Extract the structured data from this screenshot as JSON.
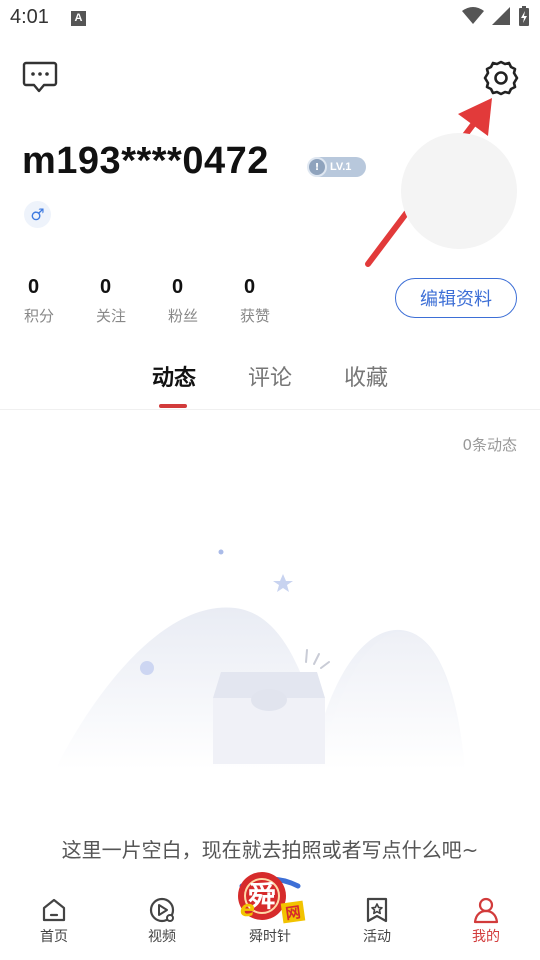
{
  "status_bar": {
    "time": "4:01",
    "notification_icon": "A"
  },
  "header": {
    "messages_icon": "chat-bubble-icon",
    "settings_icon": "gear-icon"
  },
  "profile": {
    "username": "m193****0472",
    "level": "LV.1",
    "gender_symbol": "♂",
    "edit_button_label": "编辑资料"
  },
  "stats": [
    {
      "value": "0",
      "label": "积分"
    },
    {
      "value": "0",
      "label": "关注"
    },
    {
      "value": "0",
      "label": "粉丝"
    },
    {
      "value": "0",
      "label": "获赞"
    }
  ],
  "tabs": [
    {
      "label": "动态",
      "active": true
    },
    {
      "label": "评论",
      "active": false
    },
    {
      "label": "收藏",
      "active": false
    }
  ],
  "feed": {
    "count_label": "0条动态",
    "empty_message": "这里一片空白，现在就去拍照或者写点什么吧~"
  },
  "bottom_nav": {
    "items": [
      {
        "label": "首页",
        "icon": "home-icon"
      },
      {
        "label": "视频",
        "icon": "video-icon"
      },
      {
        "label": "舜时针",
        "icon": "brand-logo-icon"
      },
      {
        "label": "活动",
        "icon": "star-bookmark-icon"
      },
      {
        "label": "我的",
        "icon": "user-icon"
      }
    ]
  },
  "colors": {
    "accent_red": "#d23b3b",
    "accent_blue": "#3d6fd6",
    "arrow_red": "#e23a3a"
  }
}
